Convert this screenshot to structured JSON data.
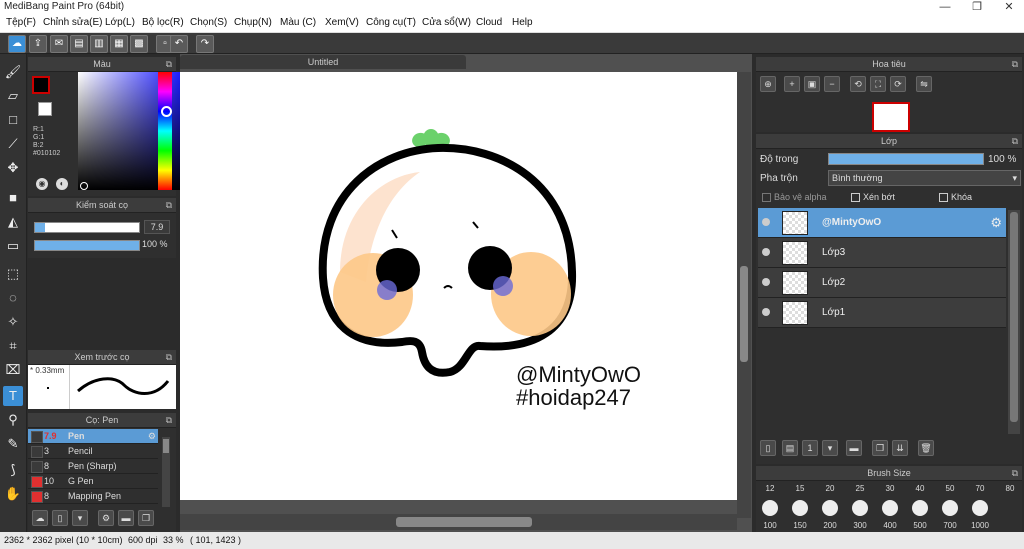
{
  "window": {
    "title": "MediBang Paint Pro (64bit)",
    "minimize": "—",
    "maximize": "❐",
    "close": "✕"
  },
  "menu": [
    "Tệp(F)",
    "Chỉnh sửa(E)",
    "Lớp(L)",
    "Bộ lọc(R)",
    "Chọn(S)",
    "Chụp(N)",
    "Màu (C)",
    "Xem(V)",
    "Công cụ(T)",
    "Cửa sổ(W)",
    "Cloud",
    "Help"
  ],
  "document": {
    "tab": "Untitled",
    "signature_line1": "@MintyOwO",
    "signature_line2": "#hoidap247"
  },
  "color_panel": {
    "title": "Màu",
    "r": "R:1",
    "g": "G:1",
    "b": "B:2",
    "hex": "#010102",
    "foreground": "#010102",
    "accent": "#cc0000"
  },
  "brush_control": {
    "title": "Kiểm soát cọ",
    "size": "7.9",
    "opacity": "100 %",
    "size_fraction": 0.1,
    "opacity_fraction": 1.0
  },
  "brush_preview": {
    "title": "Xem trước cọ",
    "size": "0.33mm"
  },
  "brush_panel": {
    "title": "Cọ: Pen",
    "items": [
      {
        "size": "7.9",
        "name": "Pen",
        "color": "#3a3a3a"
      },
      {
        "size": "3",
        "name": "Pencil",
        "color": "#3a3a3a"
      },
      {
        "size": "8",
        "name": "Pen (Sharp)",
        "color": "#3a3a3a"
      },
      {
        "size": "10",
        "name": "G Pen",
        "color": "#e03030"
      },
      {
        "size": "8",
        "name": "Mapping Pen",
        "color": "#e03030"
      }
    ]
  },
  "navigator": {
    "title": "Hoa tiêu"
  },
  "layer_panel": {
    "title": "Lớp",
    "opacity_label": "Độ trong",
    "opacity_value": "100 %",
    "blend_label": "Pha trộn",
    "blend_value": "Bình thường",
    "protect_alpha": "Bảo vệ alpha",
    "clipping": "Xén bớt",
    "lock": "Khóa",
    "layers": [
      {
        "name": "@MintyOwO",
        "selected": true
      },
      {
        "name": "Lớp3",
        "selected": false
      },
      {
        "name": "Lớp2",
        "selected": false
      },
      {
        "name": "Lớp1",
        "selected": false
      }
    ]
  },
  "brush_size_panel": {
    "title": "Brush Size",
    "top": [
      "12",
      "15",
      "20",
      "25",
      "30",
      "40",
      "50",
      "70",
      "80"
    ],
    "bottom": [
      "100",
      "150",
      "200",
      "300",
      "400",
      "500",
      "700",
      "1000"
    ]
  },
  "status": {
    "dimensions": "2362 * 2362 pixel",
    "size_cm": "(10 * 10cm)",
    "dpi": "600 dpi",
    "zoom": "33 %",
    "cursor": "( 101, 1423 )"
  }
}
